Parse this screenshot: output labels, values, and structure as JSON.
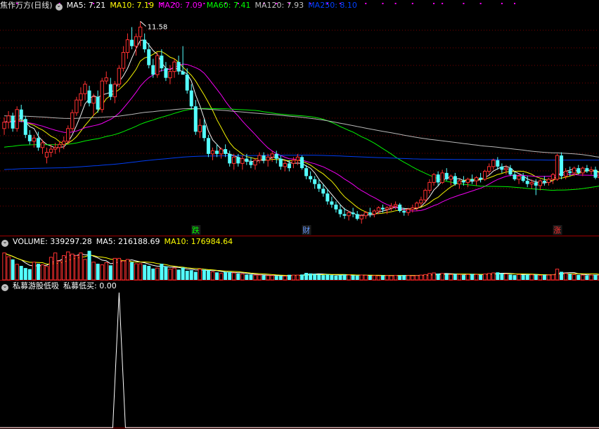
{
  "main_header": {
    "title": "焦作万方(日线)",
    "ma": [
      {
        "label": "MA5: 7.21",
        "color": "#ffffff"
      },
      {
        "label": "MA10: 7.19",
        "color": "#ffff00"
      },
      {
        "label": "MA20: 7.09",
        "color": "#ff00ff"
      },
      {
        "label": "MA60: 7.41",
        "color": "#00ff00"
      },
      {
        "label": "MA120: 7.93",
        "color": "#c0c0c0"
      },
      {
        "label": "MA250: 8.10",
        "color": "#0040ff"
      }
    ]
  },
  "volume_header": {
    "title": "VOLUME: 339297.28",
    "ma5": "MA5: 216188.69",
    "ma10": "MA10: 176984.64"
  },
  "indicator_header": {
    "title": "私募游股低吸",
    "value": "私募低买: 0.00"
  },
  "colors": {
    "up": "#ff3030",
    "down": "#54ffff",
    "grid": "#7a0000",
    "divider": "#a00000"
  },
  "chart_data": {
    "type": "candlestick",
    "price_axis": {
      "min": 5.2,
      "max": 11.9
    },
    "high_marker": {
      "label": "11.58",
      "bar_index": 32
    },
    "event_labels": [
      {
        "text": "跌",
        "bar_index": 45,
        "color": "#00ff00"
      },
      {
        "text": "财",
        "bar_index": 71,
        "color": "#6699ff"
      },
      {
        "text": "涨",
        "bar_index": 130,
        "color": "#ff3030"
      }
    ],
    "candles": [
      [
        8.2,
        8.55,
        8.0,
        8.4
      ],
      [
        8.4,
        8.75,
        8.2,
        8.6
      ],
      [
        8.6,
        8.7,
        8.1,
        8.2
      ],
      [
        8.2,
        8.9,
        8.1,
        8.8
      ],
      [
        8.8,
        8.95,
        8.4,
        8.5
      ],
      [
        8.5,
        8.6,
        7.9,
        8.0
      ],
      [
        8.0,
        8.15,
        7.7,
        7.8
      ],
      [
        7.8,
        8.0,
        7.6,
        7.9
      ],
      [
        7.9,
        8.1,
        7.5,
        7.6
      ],
      [
        7.6,
        7.85,
        7.4,
        7.75
      ],
      [
        7.3,
        7.6,
        7.1,
        7.45
      ],
      [
        7.45,
        7.7,
        7.3,
        7.55
      ],
      [
        7.55,
        7.75,
        7.4,
        7.6
      ],
      [
        7.6,
        7.8,
        7.45,
        7.7
      ],
      [
        7.7,
        7.95,
        7.55,
        7.8
      ],
      [
        7.8,
        8.3,
        7.7,
        8.2
      ],
      [
        8.2,
        8.8,
        8.1,
        8.7
      ],
      [
        8.7,
        9.2,
        8.6,
        9.1
      ],
      [
        9.1,
        9.5,
        8.9,
        9.3
      ],
      [
        9.3,
        9.7,
        9.1,
        9.6
      ],
      [
        9.4,
        9.55,
        8.9,
        9.0
      ],
      [
        9.0,
        9.3,
        8.6,
        9.2
      ],
      [
        9.2,
        9.4,
        8.7,
        8.8
      ],
      [
        8.8,
        9.8,
        8.7,
        9.7
      ],
      [
        9.7,
        10.0,
        9.6,
        9.8
      ],
      [
        9.6,
        9.8,
        9.1,
        9.2
      ],
      [
        9.2,
        9.7,
        9.0,
        9.6
      ],
      [
        9.6,
        10.2,
        9.5,
        10.1
      ],
      [
        10.1,
        10.8,
        10.0,
        10.6
      ],
      [
        10.6,
        11.2,
        10.4,
        11.0
      ],
      [
        11.0,
        11.4,
        10.7,
        10.8
      ],
      [
        10.8,
        11.2,
        10.5,
        11.1
      ],
      [
        11.1,
        11.58,
        10.8,
        11.4
      ],
      [
        11.0,
        11.2,
        10.6,
        10.7
      ],
      [
        10.7,
        10.9,
        10.1,
        10.2
      ],
      [
        10.2,
        10.4,
        9.8,
        9.9
      ],
      [
        9.9,
        10.6,
        9.8,
        10.5
      ],
      [
        10.5,
        10.7,
        10.0,
        10.1
      ],
      [
        10.1,
        10.3,
        9.7,
        9.8
      ],
      [
        9.8,
        10.2,
        9.6,
        10.0
      ],
      [
        10.0,
        10.4,
        9.8,
        10.3
      ],
      [
        10.3,
        10.5,
        9.9,
        10.0
      ],
      [
        10.0,
        10.8,
        9.9,
        9.9
      ],
      [
        9.9,
        10.1,
        9.3,
        9.4
      ],
      [
        9.4,
        9.6,
        8.8,
        8.9
      ],
      [
        8.9,
        9.1,
        8.0,
        8.1
      ],
      [
        8.1,
        8.5,
        7.9,
        8.3
      ],
      [
        8.3,
        8.5,
        7.8,
        7.9
      ],
      [
        7.9,
        8.0,
        7.3,
        7.4
      ],
      [
        7.4,
        7.6,
        7.2,
        7.5
      ],
      [
        7.5,
        7.7,
        7.3,
        7.4
      ],
      [
        7.4,
        7.6,
        7.25,
        7.55
      ],
      [
        7.55,
        7.7,
        7.3,
        7.4
      ],
      [
        7.4,
        7.5,
        7.0,
        7.1
      ],
      [
        7.1,
        7.4,
        6.9,
        7.3
      ],
      [
        7.3,
        7.4,
        7.0,
        7.1
      ],
      [
        7.1,
        7.35,
        6.9,
        7.25
      ],
      [
        7.25,
        7.4,
        7.05,
        7.15
      ],
      [
        7.15,
        7.3,
        6.95,
        7.05
      ],
      [
        7.05,
        7.25,
        6.9,
        7.2
      ],
      [
        7.2,
        7.45,
        7.1,
        7.35
      ],
      [
        7.35,
        7.45,
        7.1,
        7.2
      ],
      [
        7.2,
        7.4,
        7.0,
        7.3
      ],
      [
        7.3,
        7.5,
        7.15,
        7.4
      ],
      [
        7.4,
        7.5,
        7.1,
        7.25
      ],
      [
        7.25,
        7.35,
        6.9,
        7.0
      ],
      [
        7.0,
        7.2,
        6.85,
        7.1
      ],
      [
        7.1,
        7.2,
        6.85,
        6.95
      ],
      [
        7.1,
        7.3,
        6.95,
        7.2
      ],
      [
        7.2,
        7.4,
        7.05,
        7.3
      ],
      [
        7.3,
        7.35,
        6.9,
        6.95
      ],
      [
        6.95,
        7.05,
        6.6,
        6.7
      ],
      [
        6.7,
        6.85,
        6.5,
        6.6
      ],
      [
        6.6,
        6.7,
        6.3,
        6.45
      ],
      [
        6.45,
        6.6,
        6.2,
        6.3
      ],
      [
        6.3,
        6.45,
        6.05,
        6.15
      ],
      [
        6.15,
        6.3,
        5.8,
        5.9
      ],
      [
        5.9,
        6.05,
        5.7,
        5.8
      ],
      [
        5.8,
        5.9,
        5.55,
        5.65
      ],
      [
        5.65,
        5.8,
        5.4,
        5.5
      ],
      [
        5.5,
        5.7,
        5.35,
        5.45
      ],
      [
        5.45,
        5.6,
        5.3,
        5.55
      ],
      [
        5.55,
        5.7,
        5.4,
        5.5
      ],
      [
        5.5,
        5.6,
        5.3,
        5.35
      ],
      [
        5.35,
        5.5,
        5.2,
        5.45
      ],
      [
        5.45,
        5.6,
        5.35,
        5.55
      ],
      [
        5.55,
        5.7,
        5.4,
        5.5
      ],
      [
        5.5,
        5.65,
        5.4,
        5.6
      ],
      [
        5.6,
        5.75,
        5.5,
        5.7
      ],
      [
        5.7,
        5.8,
        5.55,
        5.65
      ],
      [
        5.65,
        5.75,
        5.5,
        5.7
      ],
      [
        5.7,
        5.85,
        5.6,
        5.75
      ],
      [
        5.75,
        5.9,
        5.65,
        5.8
      ],
      [
        5.8,
        5.85,
        5.55,
        5.6
      ],
      [
        5.6,
        5.7,
        5.45,
        5.55
      ],
      [
        5.55,
        5.7,
        5.45,
        5.65
      ],
      [
        5.65,
        5.8,
        5.55,
        5.7
      ],
      [
        5.7,
        5.9,
        5.6,
        5.85
      ],
      [
        5.85,
        6.05,
        5.75,
        5.95
      ],
      [
        5.95,
        6.3,
        5.85,
        6.25
      ],
      [
        6.25,
        6.6,
        6.15,
        6.5
      ],
      [
        6.5,
        6.8,
        6.4,
        6.75
      ],
      [
        6.75,
        6.85,
        6.4,
        6.5
      ],
      [
        6.5,
        6.9,
        6.45,
        6.8
      ],
      [
        6.8,
        6.95,
        6.55,
        6.6
      ],
      [
        6.6,
        6.75,
        6.4,
        6.7
      ],
      [
        6.7,
        6.8,
        6.4,
        6.45
      ],
      [
        6.45,
        6.6,
        6.3,
        6.55
      ],
      [
        6.55,
        6.7,
        6.4,
        6.5
      ],
      [
        6.5,
        6.65,
        6.35,
        6.6
      ],
      [
        6.6,
        6.75,
        6.45,
        6.55
      ],
      [
        6.55,
        6.7,
        6.4,
        6.65
      ],
      [
        6.65,
        6.8,
        6.5,
        6.6
      ],
      [
        6.6,
        6.9,
        6.55,
        6.85
      ],
      [
        6.85,
        7.1,
        6.75,
        7.0
      ],
      [
        7.0,
        7.25,
        6.9,
        7.2
      ],
      [
        7.2,
        7.3,
        6.9,
        7.0
      ],
      [
        7.0,
        7.1,
        6.8,
        6.9
      ],
      [
        6.9,
        7.05,
        6.75,
        6.95
      ],
      [
        6.95,
        7.05,
        6.7,
        6.75
      ],
      [
        6.75,
        6.85,
        6.55,
        6.6
      ],
      [
        6.6,
        6.75,
        6.45,
        6.7
      ],
      [
        6.7,
        6.8,
        6.5,
        6.55
      ],
      [
        6.55,
        6.7,
        6.35,
        6.45
      ],
      [
        6.45,
        6.6,
        6.3,
        6.5
      ],
      [
        6.5,
        6.6,
        6.1,
        6.4
      ],
      [
        6.4,
        6.6,
        6.25,
        6.55
      ],
      [
        6.55,
        6.7,
        6.4,
        6.5
      ],
      [
        6.5,
        6.65,
        6.4,
        6.6
      ],
      [
        6.6,
        6.8,
        6.45,
        6.75
      ],
      [
        6.6,
        7.4,
        6.55,
        7.35
      ],
      [
        7.35,
        7.45,
        6.6,
        6.7
      ],
      [
        6.7,
        6.95,
        6.6,
        6.85
      ],
      [
        6.85,
        7.0,
        6.7,
        6.8
      ],
      [
        6.8,
        7.0,
        6.7,
        6.95
      ],
      [
        6.95,
        7.05,
        6.75,
        6.8
      ],
      [
        6.8,
        7.0,
        6.7,
        6.95
      ],
      [
        6.95,
        7.05,
        6.8,
        6.85
      ],
      [
        6.85,
        7.0,
        6.75,
        6.9
      ],
      [
        6.9,
        7.0,
        6.6,
        6.65
      ],
      [
        6.65,
        6.85,
        6.55,
        6.8
      ],
      [
        6.8,
        6.95,
        6.65,
        6.7
      ],
      [
        6.7,
        6.85,
        6.6,
        6.8
      ],
      [
        6.8,
        6.95,
        6.7,
        6.9
      ],
      [
        6.9,
        7.05,
        6.8,
        6.85
      ],
      [
        6.85,
        7.0,
        6.7,
        6.95
      ],
      [
        6.95,
        7.05,
        6.75,
        6.8
      ],
      [
        6.8,
        6.9,
        6.7,
        6.85
      ]
    ],
    "volume_axis": {
      "max": 600000
    },
    "volumes": [
      500000,
      430000,
      380000,
      290000,
      260000,
      220000,
      200000,
      330000,
      300000,
      280000,
      250000,
      420000,
      500000,
      350000,
      450000,
      520000,
      480000,
      450000,
      500000,
      380000,
      540000,
      330000,
      300000,
      280000,
      320000,
      270000,
      400000,
      400000,
      350000,
      380000,
      330000,
      300000,
      300000,
      280000,
      260000,
      210000,
      220000,
      300000,
      250000,
      200000,
      220000,
      190000,
      230000,
      170000,
      180000,
      150000,
      200000,
      190000,
      180000,
      150000,
      140000,
      120000,
      150000,
      150000,
      130000,
      120000,
      110000,
      100000,
      100000,
      90000,
      90000,
      85000,
      80000,
      80000,
      75000,
      75000,
      70000,
      95000,
      90000,
      90000,
      100000,
      130000,
      120000,
      110000,
      100000,
      90000,
      100000,
      90000,
      80000,
      90000,
      100000,
      90000,
      85000,
      80000,
      90000,
      85000,
      80000,
      80000,
      75000,
      85000,
      80000,
      75000,
      85000,
      80000,
      90000,
      80000,
      75000,
      80000,
      90000,
      100000,
      120000,
      130000,
      115000,
      120000,
      110000,
      100000,
      110000,
      100000,
      90000,
      100000,
      110000,
      100000,
      95000,
      110000,
      120000,
      130000,
      140000,
      120000,
      110000,
      100000,
      90000,
      100000,
      90000,
      100000,
      95000,
      100000,
      85000,
      95000,
      90000,
      95000,
      200000,
      150000,
      120000,
      110000,
      100000,
      95000,
      90000,
      85000,
      90000,
      95000,
      90000,
      80000,
      85000,
      80000,
      90000,
      85000,
      80000,
      85000
    ],
    "indicator_axis": {
      "max": 1
    },
    "indicator_spike": {
      "bar_index": 27,
      "value": 1
    }
  }
}
